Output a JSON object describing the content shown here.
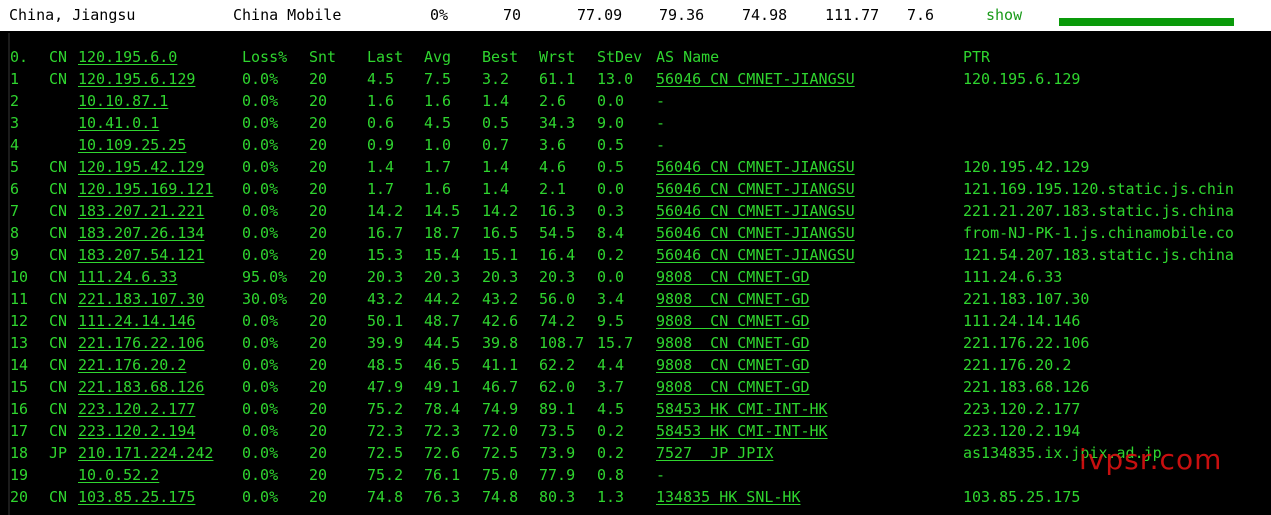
{
  "topbar": {
    "location": "China, Jiangsu",
    "isp": "China Mobile",
    "loss": "0%",
    "sent": "70",
    "last": "77.09",
    "avg": "79.36",
    "best": "74.98",
    "worst": "111.77",
    "stdev": "7.6",
    "show_label": "show"
  },
  "headers": {
    "hop": "0.",
    "cc": "CN",
    "host": "120.195.6.0",
    "loss": "Loss%",
    "snt": "Snt",
    "last": "Last",
    "avg": "Avg",
    "best": "Best",
    "wrst": "Wrst",
    "stdev": "StDev",
    "asname": "AS Name",
    "ptr": "PTR"
  },
  "hops": [
    {
      "n": "1",
      "cc": "CN",
      "host": "120.195.6.129",
      "loss": "0.0%",
      "snt": "20",
      "last": "4.5",
      "avg": "7.5",
      "best": "3.2",
      "wrst": "61.1",
      "stdev": "13.0",
      "as": "56046 CN CMNET-JIANGSU",
      "ptr": "120.195.6.129"
    },
    {
      "n": "2",
      "cc": "",
      "host": "10.10.87.1",
      "loss": "0.0%",
      "snt": "20",
      "last": "1.6",
      "avg": "1.6",
      "best": "1.4",
      "wrst": "2.6",
      "stdev": "0.0",
      "as": "-",
      "ptr": ""
    },
    {
      "n": "3",
      "cc": "",
      "host": "10.41.0.1",
      "loss": "0.0%",
      "snt": "20",
      "last": "0.6",
      "avg": "4.5",
      "best": "0.5",
      "wrst": "34.3",
      "stdev": "9.0",
      "as": "-",
      "ptr": ""
    },
    {
      "n": "4",
      "cc": "",
      "host": "10.109.25.25",
      "loss": "0.0%",
      "snt": "20",
      "last": "0.9",
      "avg": "1.0",
      "best": "0.7",
      "wrst": "3.6",
      "stdev": "0.5",
      "as": "-",
      "ptr": ""
    },
    {
      "n": "5",
      "cc": "CN",
      "host": "120.195.42.129",
      "loss": "0.0%",
      "snt": "20",
      "last": "1.4",
      "avg": "1.7",
      "best": "1.4",
      "wrst": "4.6",
      "stdev": "0.5",
      "as": "56046 CN CMNET-JIANGSU",
      "ptr": "120.195.42.129"
    },
    {
      "n": "6",
      "cc": "CN",
      "host": "120.195.169.121",
      "loss": "0.0%",
      "snt": "20",
      "last": "1.7",
      "avg": "1.6",
      "best": "1.4",
      "wrst": "2.1",
      "stdev": "0.0",
      "as": "56046 CN CMNET-JIANGSU",
      "ptr": "121.169.195.120.static.js.chin"
    },
    {
      "n": "7",
      "cc": "CN",
      "host": "183.207.21.221",
      "loss": "0.0%",
      "snt": "20",
      "last": "14.2",
      "avg": "14.5",
      "best": "14.2",
      "wrst": "16.3",
      "stdev": "0.3",
      "as": "56046 CN CMNET-JIANGSU",
      "ptr": "221.21.207.183.static.js.china"
    },
    {
      "n": "8",
      "cc": "CN",
      "host": "183.207.26.134",
      "loss": "0.0%",
      "snt": "20",
      "last": "16.7",
      "avg": "18.7",
      "best": "16.5",
      "wrst": "54.5",
      "stdev": "8.4",
      "as": "56046 CN CMNET-JIANGSU",
      "ptr": "from-NJ-PK-1.js.chinamobile.co"
    },
    {
      "n": "9",
      "cc": "CN",
      "host": "183.207.54.121",
      "loss": "0.0%",
      "snt": "20",
      "last": "15.3",
      "avg": "15.4",
      "best": "15.1",
      "wrst": "16.4",
      "stdev": "0.2",
      "as": "56046 CN CMNET-JIANGSU",
      "ptr": "121.54.207.183.static.js.china"
    },
    {
      "n": "10",
      "cc": "CN",
      "host": "111.24.6.33",
      "loss": "95.0%",
      "snt": "20",
      "last": "20.3",
      "avg": "20.3",
      "best": "20.3",
      "wrst": "20.3",
      "stdev": "0.0",
      "as": "9808  CN CMNET-GD",
      "ptr": "111.24.6.33"
    },
    {
      "n": "11",
      "cc": "CN",
      "host": "221.183.107.30",
      "loss": "30.0%",
      "snt": "20",
      "last": "43.2",
      "avg": "44.2",
      "best": "43.2",
      "wrst": "56.0",
      "stdev": "3.4",
      "as": "9808  CN CMNET-GD",
      "ptr": "221.183.107.30"
    },
    {
      "n": "12",
      "cc": "CN",
      "host": "111.24.14.146",
      "loss": "0.0%",
      "snt": "20",
      "last": "50.1",
      "avg": "48.7",
      "best": "42.6",
      "wrst": "74.2",
      "stdev": "9.5",
      "as": "9808  CN CMNET-GD",
      "ptr": "111.24.14.146"
    },
    {
      "n": "13",
      "cc": "CN",
      "host": "221.176.22.106",
      "loss": "0.0%",
      "snt": "20",
      "last": "39.9",
      "avg": "44.5",
      "best": "39.8",
      "wrst": "108.7",
      "stdev": "15.7",
      "as": "9808  CN CMNET-GD",
      "ptr": "221.176.22.106"
    },
    {
      "n": "14",
      "cc": "CN",
      "host": "221.176.20.2",
      "loss": "0.0%",
      "snt": "20",
      "last": "48.5",
      "avg": "46.5",
      "best": "41.1",
      "wrst": "62.2",
      "stdev": "4.4",
      "as": "9808  CN CMNET-GD",
      "ptr": "221.176.20.2"
    },
    {
      "n": "15",
      "cc": "CN",
      "host": "221.183.68.126",
      "loss": "0.0%",
      "snt": "20",
      "last": "47.9",
      "avg": "49.1",
      "best": "46.7",
      "wrst": "62.0",
      "stdev": "3.7",
      "as": "9808  CN CMNET-GD",
      "ptr": "221.183.68.126"
    },
    {
      "n": "16",
      "cc": "CN",
      "host": "223.120.2.177",
      "loss": "0.0%",
      "snt": "20",
      "last": "75.2",
      "avg": "78.4",
      "best": "74.9",
      "wrst": "89.1",
      "stdev": "4.5",
      "as": "58453 HK CMI-INT-HK",
      "ptr": "223.120.2.177"
    },
    {
      "n": "17",
      "cc": "CN",
      "host": "223.120.2.194",
      "loss": "0.0%",
      "snt": "20",
      "last": "72.3",
      "avg": "72.3",
      "best": "72.0",
      "wrst": "73.5",
      "stdev": "0.2",
      "as": "58453 HK CMI-INT-HK",
      "ptr": "223.120.2.194"
    },
    {
      "n": "18",
      "cc": "JP",
      "host": "210.171.224.242",
      "loss": "0.0%",
      "snt": "20",
      "last": "72.5",
      "avg": "72.6",
      "best": "72.5",
      "wrst": "73.9",
      "stdev": "0.2",
      "as": "7527  JP JPIX",
      "ptr": "as134835.ix.jpix.ad.jp"
    },
    {
      "n": "19",
      "cc": "",
      "host": "10.0.52.2",
      "loss": "0.0%",
      "snt": "20",
      "last": "75.2",
      "avg": "76.1",
      "best": "75.0",
      "wrst": "77.9",
      "stdev": "0.8",
      "as": "-",
      "ptr": ""
    },
    {
      "n": "20",
      "cc": "CN",
      "host": "103.85.25.175",
      "loss": "0.0%",
      "snt": "20",
      "last": "74.8",
      "avg": "76.3",
      "best": "74.8",
      "wrst": "80.3",
      "stdev": "1.3",
      "as": "134835 HK SNL-HK",
      "ptr": "103.85.25.175"
    }
  ],
  "watermark": "ivpsr.com",
  "colors": {
    "text": "#2fd52f",
    "bg": "#000000",
    "watermark": "#dd1111"
  }
}
